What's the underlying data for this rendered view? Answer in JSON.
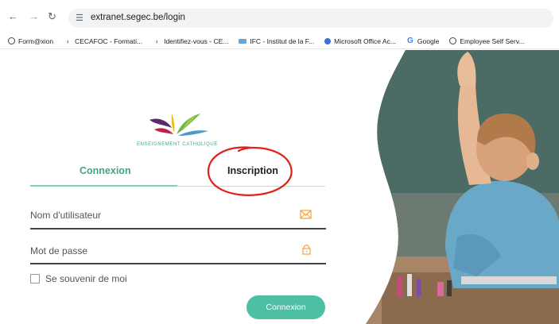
{
  "browser": {
    "url": "extranet.segec.be/login",
    "bookmarks": [
      {
        "label": "Form@xion",
        "icon": "globe-icon"
      },
      {
        "label": "CECAFOC - Formati...",
        "icon": "arrow-icon"
      },
      {
        "label": "Identifiez-vous - CE...",
        "icon": "arrow-icon"
      },
      {
        "label": "IFC - Institut de la F...",
        "icon": "ifc-icon"
      },
      {
        "label": "Microsoft Office Ac...",
        "icon": "microsoft-icon"
      },
      {
        "label": "Google",
        "icon": "google-icon"
      },
      {
        "label": "Employee Self Serv...",
        "icon": "globe-icon"
      }
    ]
  },
  "brand": {
    "name": "ENSEIGNEMENT CATHOLIQUE"
  },
  "tabs": {
    "login": "Connexion",
    "signup": "Inscription",
    "active": "login"
  },
  "form": {
    "username_placeholder": "Nom d'utilisateur",
    "password_placeholder": "Mot de passe",
    "remember_label": "Se souvenir de moi",
    "remember_checked": false,
    "submit_label": "Connexion"
  },
  "colors": {
    "accent": "#4ebfa3",
    "annotation": "#e0201b",
    "icon_orange": "#f0a23c"
  }
}
